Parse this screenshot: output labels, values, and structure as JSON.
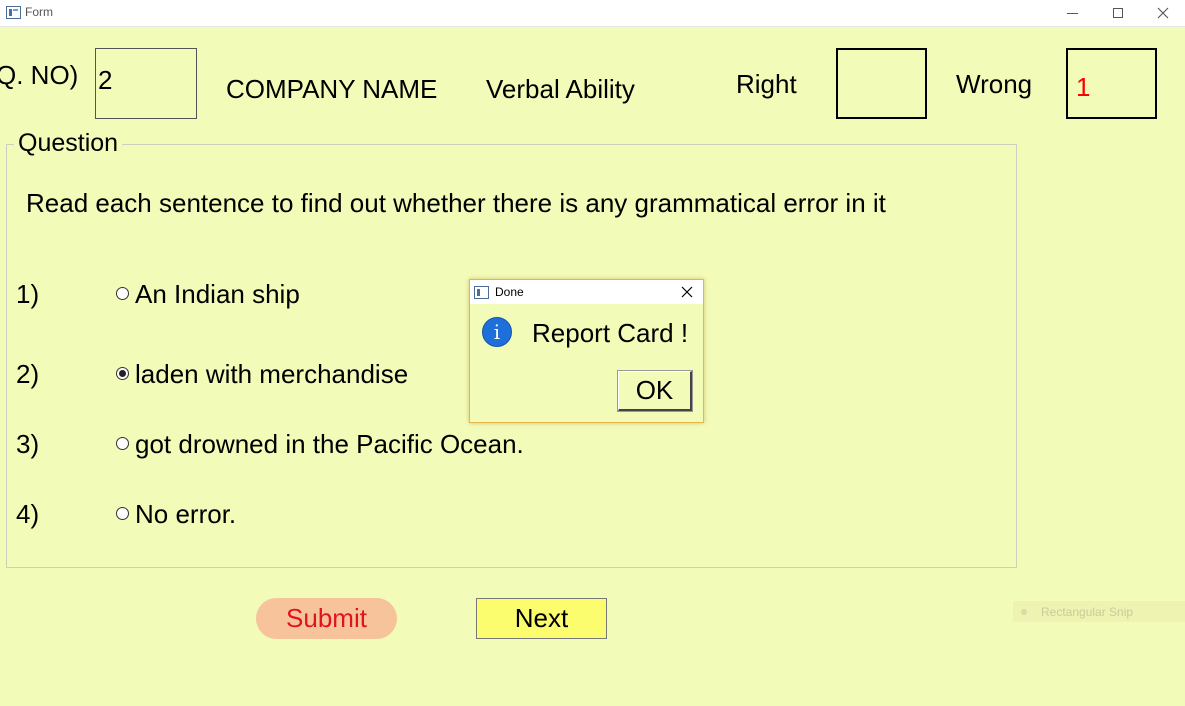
{
  "window": {
    "title": "Form",
    "icon": "form-app-icon"
  },
  "header": {
    "qno_label": "Q. NO)",
    "qno_value": "2",
    "company_name": "COMPANY NAME",
    "category": "Verbal Ability",
    "right_label": "Right",
    "right_value": "",
    "wrong_label": "Wrong",
    "wrong_value": "1"
  },
  "question": {
    "group_title": "Question",
    "text": "Read each sentence to find out whether there is any grammatical error in it",
    "options": [
      {
        "number": "1)",
        "text": "An Indian ship",
        "selected": false
      },
      {
        "number": "2)",
        "text": "laden with merchandise",
        "selected": true
      },
      {
        "number": "3)",
        "text": "got drowned in the Pacific Ocean.",
        "selected": false
      },
      {
        "number": "4)",
        "text": "No error.",
        "selected": false
      }
    ]
  },
  "buttons": {
    "submit": "Submit",
    "next": "Next"
  },
  "dialog": {
    "title": "Done",
    "message": "Report Card !",
    "ok": "OK",
    "icon": "info-icon"
  },
  "overlay": {
    "snip_label": "Rectangular Snip"
  },
  "colors": {
    "background": "#f3fbb8",
    "wrong_value": "#ff0000",
    "submit_bg": "#f7c39a",
    "submit_text": "#e0141e",
    "next_bg": "#fbfc6e",
    "info_icon": "#1e6fd9"
  }
}
